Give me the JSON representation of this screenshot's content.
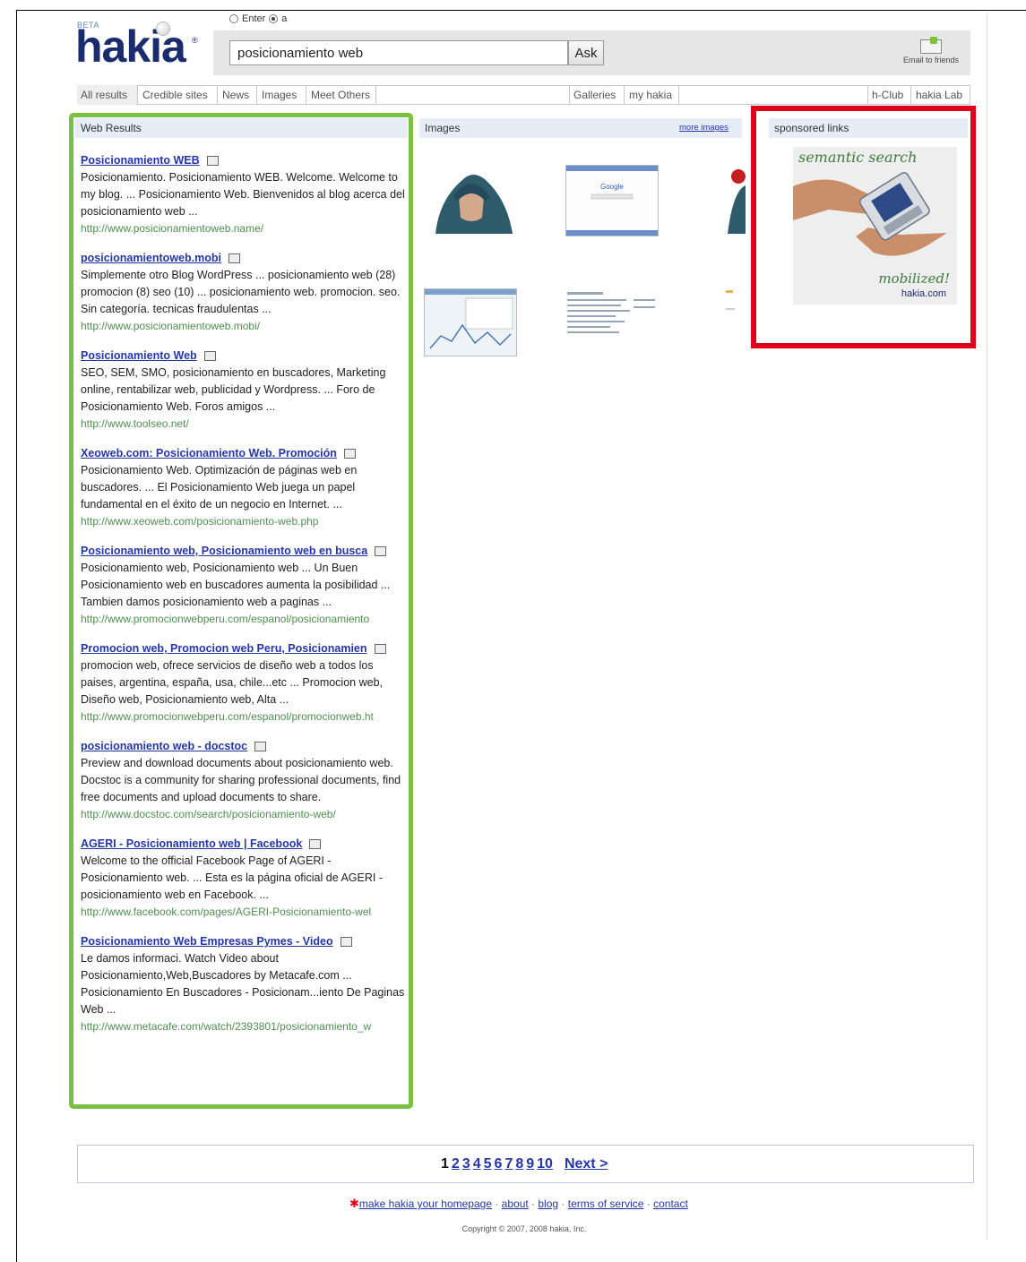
{
  "header": {
    "beta": "BETA",
    "logo": "hakia",
    "logo_mark": "®",
    "radio_enter": "Enter",
    "radio_a": "a",
    "search_value": "posicionamiento web",
    "ask_label": "Ask",
    "email_friends": "Email to friends"
  },
  "tabs_left": [
    "All results",
    "Credible sites",
    "News",
    "Images",
    "Meet Others"
  ],
  "tabs_mid": [
    "Galleries",
    "my hakia"
  ],
  "tabs_right": [
    "h-Club",
    "hakia Lab"
  ],
  "web_results": {
    "heading": "Web Results",
    "items": [
      {
        "title": "Posicionamiento WEB",
        "snippet": "Posicionamiento. Posicionamiento WEB. Welcome. Welcome to my blog. ... Posicionamiento Web. Bienvenidos al blog acerca del posicionamiento web ...",
        "url": "http://www.posicionamientoweb.name/"
      },
      {
        "title": "posicionamientoweb.mobi",
        "snippet": "Simplemente otro Blog WordPress ... posicionamiento web (28) promocion (8) seo (10) ... posicionamiento web. promocion. seo. Sin categoría. tecnicas fraudulentas ...",
        "url": "http://www.posicionamientoweb.mobi/"
      },
      {
        "title": "Posicionamiento Web",
        "snippet": "SEO, SEM, SMO, posicionamiento en buscadores, Marketing online, rentabilizar web, publicidad y Wordpress. ... Foro de Posicionamiento Web. Foros amigos ...",
        "url": "http://www.toolseo.net/"
      },
      {
        "title": "Xeoweb.com: Posicionamiento Web. Promoción",
        "snippet": "Posicionamiento Web. Optimización de páginas web en buscadores. ... El Posicionamiento Web juega un papel fundamental en el éxito de un negocio en Internet. ...",
        "url": "http://www.xeoweb.com/posicionamiento-web.php"
      },
      {
        "title": "Posicionamiento web, Posicionamiento web en busca",
        "snippet": "Posicionamiento web, Posicionamiento web ... Un Buen Posicionamiento web en buscadores aumenta la posibilidad ... Tambien damos posicionamiento web a paginas ...",
        "url": "http://www.promocionwebperu.com/espanol/posicionamiento"
      },
      {
        "title": "Promocion web, Promocion web Peru, Posicionamien",
        "snippet": "promocion web, ofrece servicios de diseño web a todos los paises, argentina, españa, usa, chile...etc ... Promocion web, Diseño web, Posicionamiento web, Alta ...",
        "url": "http://www.promocionwebperu.com/espanol/promocionweb.ht"
      },
      {
        "title": "posicionamiento web - docstoc",
        "snippet": "Preview and download documents about posicionamiento web. Docstoc is a community for sharing professional documents, find free documents and upload documents to share.",
        "url": "http://www.docstoc.com/search/posicionamiento-web/"
      },
      {
        "title": "AGERI - Posicionamiento web | Facebook",
        "snippet": "Welcome to the official Facebook Page of AGERI - Posicionamiento web. ... Esta es la página oficial de AGERI - posicionamiento web en Facebook. ...",
        "url": "http://www.facebook.com/pages/AGERI-Posicionamiento-wel"
      },
      {
        "title": "Posicionamiento Web Empresas Pymes - Video",
        "snippet": "Le damos informaci. Watch Video about Posicionamiento,Web,Buscadores by Metacafe.com ... Posicionamiento En Buscadores - Posicionam...iento De Paginas Web ...",
        "url": "http://www.metacafe.com/watch/2393801/posicionamiento_w"
      }
    ]
  },
  "images": {
    "heading": "Images",
    "more": "more images"
  },
  "sponsored": {
    "heading": "sponsored links",
    "ad_line1": "semantic search",
    "ad_line2": "mobilized!",
    "ad_line3": "hakia.com"
  },
  "pagination": {
    "current": "1",
    "pages": [
      "2",
      "3",
      "4",
      "5",
      "6",
      "7",
      "8",
      "9",
      "10"
    ],
    "next": "Next >"
  },
  "footer": {
    "homepage": "make hakia your homepage",
    "about": "about",
    "blog": "blog",
    "terms": "terms of service",
    "contact": "contact",
    "copyright": "Copyright © 2007, 2008 hakia, Inc."
  }
}
